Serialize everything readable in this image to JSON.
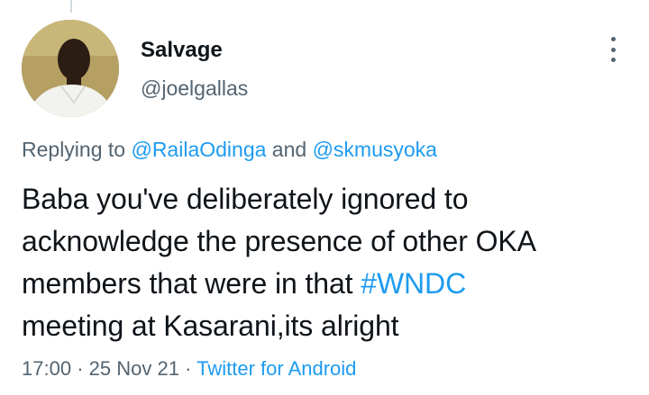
{
  "tweet": {
    "display_name": "Salvage",
    "handle": "@joelgallas",
    "replying_prefix": "Replying to",
    "reply_to_1": "@RailaOdinga",
    "reply_and": "and",
    "reply_to_2": "@skmusyoka",
    "text_line1": "Baba you've deliberately ignored to",
    "text_line2": "acknowledge the presence of other OKA",
    "text_line3_pre": "members that were in that",
    "hashtag": "#WNDC",
    "text_line4": "meeting at Kasarani,its alright",
    "time": "17:00",
    "separator": "·",
    "date": "25 Nov 21",
    "source": "Twitter for Android"
  },
  "icons": {
    "more": "more-vertical-icon",
    "avatar": "user-avatar"
  },
  "colors": {
    "link": "#1d9bf0",
    "secondary_text": "#536471",
    "primary_text": "#0f1419"
  }
}
